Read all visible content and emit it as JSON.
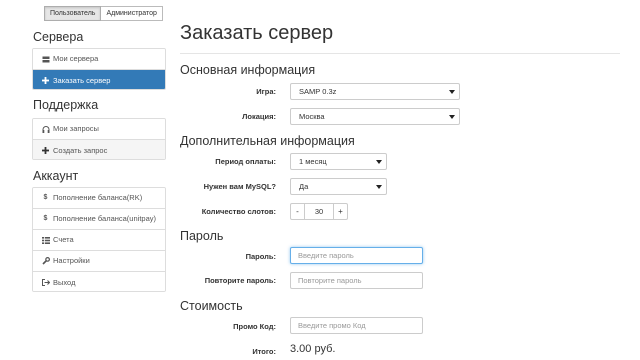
{
  "role_tabs": [
    "Пользователь",
    "Администратор"
  ],
  "sidebar": {
    "servers_title": "Сервера",
    "servers_items": [
      {
        "label": "Мои сервера",
        "icon": "server-icon"
      },
      {
        "label": "Заказать сервер",
        "icon": "plus-icon",
        "active": true
      }
    ],
    "support_title": "Поддержка",
    "support_items": [
      {
        "label": "Мои запросы",
        "icon": "headphones-icon"
      },
      {
        "label": "Создать запрос",
        "icon": "plus-icon"
      }
    ],
    "account_title": "Аккаунт",
    "account_items": [
      {
        "label": "Пополнение баланса(RK)",
        "icon": "dollar-icon"
      },
      {
        "label": "Пополнение баланса(unitpay)",
        "icon": "dollar-icon"
      },
      {
        "label": "Счета",
        "icon": "list-icon"
      },
      {
        "label": "Настройки",
        "icon": "wrench-icon"
      },
      {
        "label": "Выход",
        "icon": "logout-icon"
      }
    ]
  },
  "main": {
    "title": "Заказать сервер",
    "basic_heading": "Основная информация",
    "game_label": "Игра:",
    "game_value": "SAMP 0.3z",
    "location_label": "Локация:",
    "location_value": "Москва",
    "extra_heading": "Дополнительная информация",
    "period_label": "Период оплаты:",
    "period_value": "1 месяц",
    "mysql_label": "Нужен вам MySQL?",
    "mysql_value": "Да",
    "slots_label": "Количество слотов:",
    "slots_value": "30",
    "minus": "-",
    "plus": "+",
    "password_heading": "Пароль",
    "password_label": "Пароль:",
    "password_placeholder": "Введите пароль",
    "repeat_label": "Повторите пароль:",
    "repeat_placeholder": "Повторите пароль",
    "cost_heading": "Стоимость",
    "promo_label": "Промо Код:",
    "promo_placeholder": "Введите промо Код",
    "total_label": "Итого:",
    "total_value": "3.00 руб."
  },
  "colors": {
    "accent": "#337ab7",
    "focus": "#66afe9"
  }
}
